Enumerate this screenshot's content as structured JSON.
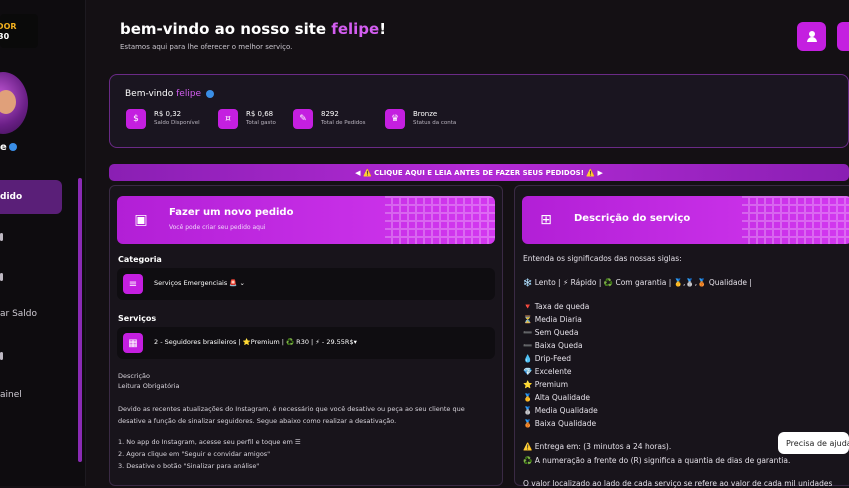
{
  "sidebar": {
    "logo_line1": "EEDOR",
    "logo_line2": "30",
    "username_partial": "e",
    "items": [
      {
        "label": "dido"
      },
      {
        "label": ""
      },
      {
        "label": ""
      },
      {
        "label": "ar Saldo"
      },
      {
        "label": ""
      },
      {
        "label": "ainel"
      }
    ]
  },
  "header": {
    "welcome_prefix": "bem-vindo ao nosso site ",
    "username": "felipe",
    "welcome_suffix": "!",
    "subtitle": "Estamos aqui para lhe oferecer o melhor serviço."
  },
  "stats": {
    "welcome_prefix": "Bem-vindo ",
    "username": "felipe",
    "items": [
      {
        "value": "R$ 0,32",
        "label": "Saldo Disponível",
        "icon": "wallet-icon"
      },
      {
        "value": "R$ 0,68",
        "label": "Total gasto",
        "icon": "money-icon"
      },
      {
        "value": "8292",
        "label": "Total de Pedidos",
        "icon": "ticket-icon"
      },
      {
        "value": "Bronze",
        "label": "Status da conta",
        "icon": "crown-icon"
      }
    ]
  },
  "notice": "◀ ⚠️ CLIQUE AQUI E LEIA ANTES DE FAZER SEUS PEDIDOS! ⚠️ ▶",
  "order": {
    "banner_title": "Fazer um novo pedido",
    "banner_subtitle": "Você pode criar seu pedido aqui",
    "category_label": "Categoria",
    "category_value": "Serviços Emergenciais 🚨",
    "services_label": "Serviços",
    "service_value": "2 - Seguidores brasileiros | ⭐Premium | ♻️ R30 | ⚡ - 29.55R$",
    "description_label": "Descrição",
    "description_lines": [
      "Leitura Obrigatória",
      "",
      "Devido as recentes atualizações do Instagram, é necessário que você desative ou peça ao seu cliente que",
      "desative a função de sinalizar seguidores. Segue abaixo como realizar a desativação.",
      "",
      "1. No app do Instagram, acesse seu perfil e toque em ☰",
      "2. Agora clique em \"Seguir e convidar amigos\"",
      "3. Desative o botão \"Sinalizar para análise\""
    ]
  },
  "service_description": {
    "banner_title": "Descrição do serviço",
    "intro": "Entenda os significados das nossas siglas:",
    "legend_line": "❄️ Lento | ⚡ Rápido | ♻️ Com garantia | 🥇,🥈,🥉 Qualidade |",
    "items": [
      "🔻 Taxa de queda",
      "⏳ Media Diaria",
      "➖ Sem Queda",
      "➖ Baixa Queda",
      "💧 Drip-Feed",
      "💎 Excelente",
      "⭐ Premium",
      "🥇 Alta Qualidade",
      "🥈 Media Qualidade",
      "🥉 Baixa Qualidade"
    ],
    "delivery": "⚠️ Entrega em: (3 minutos a 24 horas).",
    "guarantee": "♻️ A numeração a frente do (R) significa a quantia de dias de garantia.",
    "footer_partial": "O valor localizado ao lado de cada serviço se refere ao valor de cada mil unidades"
  },
  "help_button": "Precisa de ajuda"
}
